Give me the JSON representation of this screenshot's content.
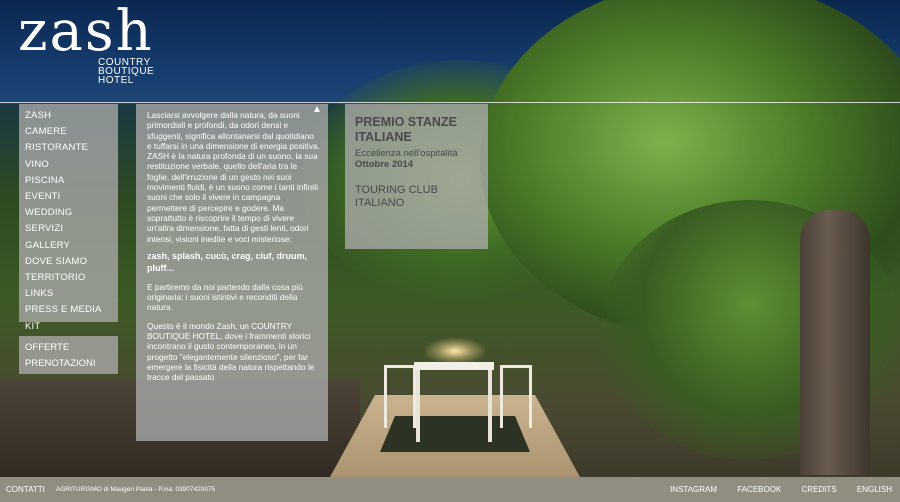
{
  "logo": {
    "word": "zash",
    "sub_lines": [
      "COUNTRY",
      "BOUTIQUE",
      "HOTEL"
    ]
  },
  "nav": {
    "items": [
      "ZASH",
      "CAMERE",
      "RISTORANTE",
      "VINO",
      "PISCINA",
      "EVENTI",
      "WEDDING",
      "SERVIZI",
      "GALLERY",
      "DOVE SIAMO",
      "TERRITORIO",
      "LINKS",
      "PRESS E MEDIA KIT"
    ],
    "secondary": [
      "OFFERTE",
      "PRENOTAZIONI"
    ]
  },
  "text_panel": {
    "scroll_up_icon": "▲",
    "p1": "Lasciarsi avvolgere dalla natura, da suoni primordiali e profondi, da odori densi e sfuggenti, significa allontanarsi dal quotidiano e tuffarsi in una dimensione di energia positiva. ZASH è la natura profonda di un suono, la sua restituzione verbale, quello dell'aria tra le foglie, dell'irruzione di un gesto nei suoi movimenti fluidi, è un suono come i tanti infiniti suoni che solo il vivere in campagna permettere di percepire e godere. Ma soprattutto è riscoprire il tempo di vivere un'altra dimensione, fatta di gesti lenti, odori intensi, visioni inedite e voci misteriose:",
    "bold": "zash, splash, cucù, crag, ciuf, druum, pluff...",
    "p2": "E partiremo da noi partendo dalla cosa più originaria: i suoni istintivi e reconditi della natura.",
    "p3": "Questo è il mondo Zash, un COUNTRY BOUTIQUE HOTEL, dove i frammenti storici incontrano il gusto contemporaneo, in un progetto \"elegantemente silenzioso\", per far emergere la fisicità della natura rispettando le tracce del passato"
  },
  "award": {
    "title": "PREMIO STANZE ITALIANE",
    "subtitle": "Eccellenza nell'ospitalità",
    "date": "Ottobre 2014",
    "organization": "TOURING CLUB ITALIANO"
  },
  "footer": {
    "contact": "CONTATTI",
    "vat": "AGRITURISMO di Maugeri Paola - P.iva: 03907420075",
    "links": [
      "INSTAGRAM",
      "FACEBOOK",
      "CREDITS",
      "ENGLISH"
    ]
  }
}
